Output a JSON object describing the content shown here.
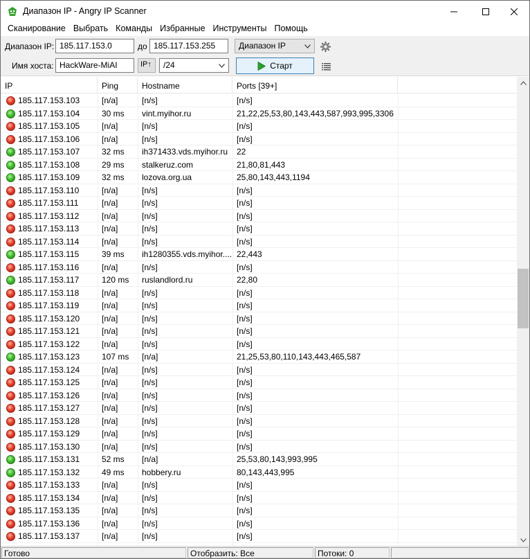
{
  "window": {
    "title": "Диапазон IP - Angry IP Scanner",
    "controls": {
      "minimize": "—",
      "maximize": "☐",
      "close": "✕"
    }
  },
  "menu": [
    "Сканирование",
    "Выбрать",
    "Команды",
    "Избранные",
    "Инструменты",
    "Помощь"
  ],
  "toolbar": {
    "range_label": "Диапазон IP:",
    "range_from": "185.117.153.0",
    "range_to_label": "до",
    "range_to": "185.117.153.255",
    "feeder_select": "Диапазон IP",
    "hostname_label": "Имя хоста:",
    "hostname_value": "HackWare-MiAI",
    "ip_up_button": "IP↑",
    "netmask_select": "/24",
    "start_label": "Старт"
  },
  "table": {
    "columns": [
      "IP",
      "Ping",
      "Hostname",
      "Ports [39+]"
    ],
    "rows": [
      {
        "status": "dead",
        "ip": "185.117.153.103",
        "ping": "[n/a]",
        "host": "[n/s]",
        "ports": "[n/s]"
      },
      {
        "status": "alive",
        "ip": "185.117.153.104",
        "ping": "30 ms",
        "host": "vint.myihor.ru",
        "ports": "21,22,25,53,80,143,443,587,993,995,3306"
      },
      {
        "status": "dead",
        "ip": "185.117.153.105",
        "ping": "[n/a]",
        "host": "[n/s]",
        "ports": "[n/s]"
      },
      {
        "status": "dead",
        "ip": "185.117.153.106",
        "ping": "[n/a]",
        "host": "[n/s]",
        "ports": "[n/s]"
      },
      {
        "status": "alive",
        "ip": "185.117.153.107",
        "ping": "32 ms",
        "host": "ih371433.vds.myihor.ru",
        "ports": "22"
      },
      {
        "status": "alive",
        "ip": "185.117.153.108",
        "ping": "29 ms",
        "host": "stalkeruz.com",
        "ports": "21,80,81,443"
      },
      {
        "status": "alive",
        "ip": "185.117.153.109",
        "ping": "32 ms",
        "host": "lozova.org.ua",
        "ports": "25,80,143,443,1194"
      },
      {
        "status": "dead",
        "ip": "185.117.153.110",
        "ping": "[n/a]",
        "host": "[n/s]",
        "ports": "[n/s]"
      },
      {
        "status": "dead",
        "ip": "185.117.153.111",
        "ping": "[n/a]",
        "host": "[n/s]",
        "ports": "[n/s]"
      },
      {
        "status": "dead",
        "ip": "185.117.153.112",
        "ping": "[n/a]",
        "host": "[n/s]",
        "ports": "[n/s]"
      },
      {
        "status": "dead",
        "ip": "185.117.153.113",
        "ping": "[n/a]",
        "host": "[n/s]",
        "ports": "[n/s]"
      },
      {
        "status": "dead",
        "ip": "185.117.153.114",
        "ping": "[n/a]",
        "host": "[n/s]",
        "ports": "[n/s]"
      },
      {
        "status": "alive",
        "ip": "185.117.153.115",
        "ping": "39 ms",
        "host": "ih1280355.vds.myihor....",
        "ports": "22,443"
      },
      {
        "status": "dead",
        "ip": "185.117.153.116",
        "ping": "[n/a]",
        "host": "[n/s]",
        "ports": "[n/s]"
      },
      {
        "status": "alive",
        "ip": "185.117.153.117",
        "ping": "120 ms",
        "host": "ruslandlord.ru",
        "ports": "22,80"
      },
      {
        "status": "dead",
        "ip": "185.117.153.118",
        "ping": "[n/a]",
        "host": "[n/s]",
        "ports": "[n/s]"
      },
      {
        "status": "dead",
        "ip": "185.117.153.119",
        "ping": "[n/a]",
        "host": "[n/s]",
        "ports": "[n/s]"
      },
      {
        "status": "dead",
        "ip": "185.117.153.120",
        "ping": "[n/a]",
        "host": "[n/s]",
        "ports": "[n/s]"
      },
      {
        "status": "dead",
        "ip": "185.117.153.121",
        "ping": "[n/a]",
        "host": "[n/s]",
        "ports": "[n/s]"
      },
      {
        "status": "dead",
        "ip": "185.117.153.122",
        "ping": "[n/a]",
        "host": "[n/s]",
        "ports": "[n/s]"
      },
      {
        "status": "alive",
        "ip": "185.117.153.123",
        "ping": "107 ms",
        "host": "[n/a]",
        "ports": "21,25,53,80,110,143,443,465,587"
      },
      {
        "status": "dead",
        "ip": "185.117.153.124",
        "ping": "[n/a]",
        "host": "[n/s]",
        "ports": "[n/s]"
      },
      {
        "status": "dead",
        "ip": "185.117.153.125",
        "ping": "[n/a]",
        "host": "[n/s]",
        "ports": "[n/s]"
      },
      {
        "status": "dead",
        "ip": "185.117.153.126",
        "ping": "[n/a]",
        "host": "[n/s]",
        "ports": "[n/s]"
      },
      {
        "status": "dead",
        "ip": "185.117.153.127",
        "ping": "[n/a]",
        "host": "[n/s]",
        "ports": "[n/s]"
      },
      {
        "status": "dead",
        "ip": "185.117.153.128",
        "ping": "[n/a]",
        "host": "[n/s]",
        "ports": "[n/s]"
      },
      {
        "status": "dead",
        "ip": "185.117.153.129",
        "ping": "[n/a]",
        "host": "[n/s]",
        "ports": "[n/s]"
      },
      {
        "status": "dead",
        "ip": "185.117.153.130",
        "ping": "[n/a]",
        "host": "[n/s]",
        "ports": "[n/s]"
      },
      {
        "status": "alive",
        "ip": "185.117.153.131",
        "ping": "52 ms",
        "host": "[n/a]",
        "ports": "25,53,80,143,993,995"
      },
      {
        "status": "alive",
        "ip": "185.117.153.132",
        "ping": "49 ms",
        "host": "hobbery.ru",
        "ports": "80,143,443,995"
      },
      {
        "status": "dead",
        "ip": "185.117.153.133",
        "ping": "[n/a]",
        "host": "[n/s]",
        "ports": "[n/s]"
      },
      {
        "status": "dead",
        "ip": "185.117.153.134",
        "ping": "[n/a]",
        "host": "[n/s]",
        "ports": "[n/s]"
      },
      {
        "status": "dead",
        "ip": "185.117.153.135",
        "ping": "[n/a]",
        "host": "[n/s]",
        "ports": "[n/s]"
      },
      {
        "status": "dead",
        "ip": "185.117.153.136",
        "ping": "[n/a]",
        "host": "[n/s]",
        "ports": "[n/s]"
      },
      {
        "status": "dead",
        "ip": "185.117.153.137",
        "ping": "[n/a]",
        "host": "[n/s]",
        "ports": "[n/s]"
      }
    ]
  },
  "statusbar": {
    "state": "Готово",
    "display": "Отобразить: Все",
    "threads": "Потоки: 0"
  },
  "colors": {
    "alive": "#3fbf2b",
    "dead": "#e8412c",
    "start_play": "#2aa12a"
  }
}
